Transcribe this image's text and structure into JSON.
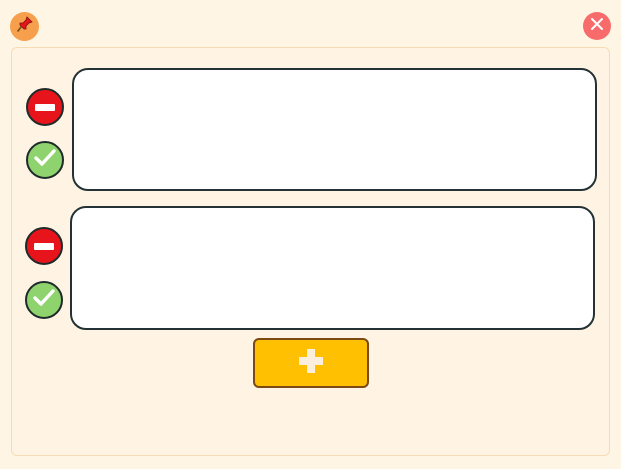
{
  "toolbar": {
    "pin_icon": "pushpin-icon",
    "close_icon": "close-icon"
  },
  "notes": [
    {
      "text": "",
      "placeholder": ""
    },
    {
      "text": "",
      "placeholder": ""
    }
  ],
  "actions": {
    "remove_icon": "minus-icon",
    "confirm_icon": "checkmark-icon",
    "add_icon": "plus-icon"
  },
  "colors": {
    "background": "#fef5e4",
    "pin": "#f6a04d",
    "close": "#f76b6b",
    "remove": "#e8141c",
    "confirm": "#8fd36e",
    "add": "#fec000",
    "input_border": "#243236"
  }
}
